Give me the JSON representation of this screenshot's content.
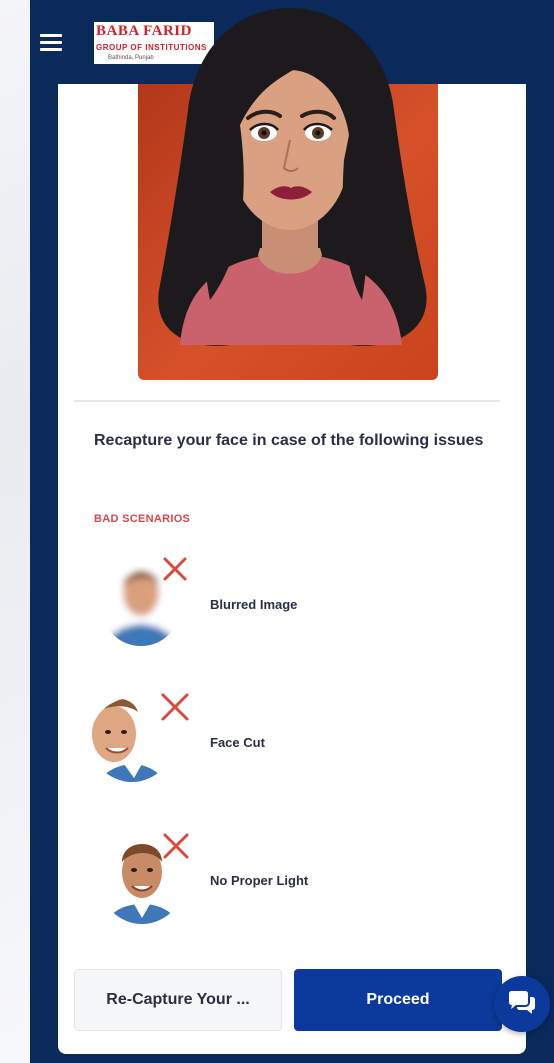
{
  "header": {
    "logo_line1": "BABA FARID",
    "logo_line2": "GROUP OF INSTITUTIONS",
    "logo_line3": "Bathinda, Punjab"
  },
  "instructions": {
    "heading": "Recapture your face in case of the following issues",
    "subheading": "BAD SCENARIOS"
  },
  "scenarios": [
    {
      "label": "Blurred Image"
    },
    {
      "label": "Face Cut"
    },
    {
      "label": "No Proper Light"
    }
  ],
  "actions": {
    "recapture_label": "Re-Capture Your ...",
    "proceed_label": "Proceed"
  },
  "icons": {
    "menu": "hamburger-menu-icon",
    "bad": "cross-icon",
    "chat": "chat-icon"
  },
  "colors": {
    "header_bg": "#0a2a5c",
    "primary_button": "#0b3a9c",
    "bad_scenarios_label": "#d8474b",
    "cross": "#d94a3a"
  }
}
